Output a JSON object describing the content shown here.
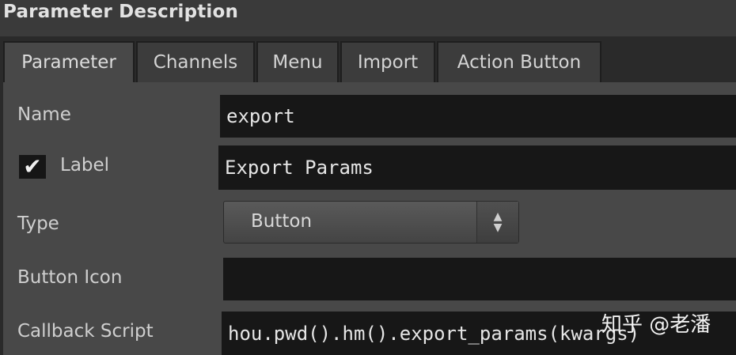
{
  "header": {
    "title": "Parameter Description"
  },
  "tabs": [
    {
      "label": "Parameter",
      "active": true
    },
    {
      "label": "Channels",
      "active": false
    },
    {
      "label": "Menu",
      "active": false
    },
    {
      "label": "Import",
      "active": false
    },
    {
      "label": "Action Button",
      "active": false
    }
  ],
  "form": {
    "name_label": "Name",
    "name_value": "export",
    "label_label": "Label",
    "label_checked": true,
    "label_value": "Export Params",
    "type_label": "Type",
    "type_value": "Button",
    "button_icon_label": "Button Icon",
    "button_icon_value": "",
    "callback_label": "Callback Script",
    "callback_value": "hou.pwd().hm().export_params(kwargs)"
  },
  "icons": {
    "check": "✔",
    "select_up": "▲",
    "select_down": "▼"
  },
  "watermark": {
    "text": "知乎 @老潘"
  },
  "colors": {
    "panel_bg": "#484848",
    "field_bg": "#171717",
    "tab_bg": "#3c3c3c"
  }
}
